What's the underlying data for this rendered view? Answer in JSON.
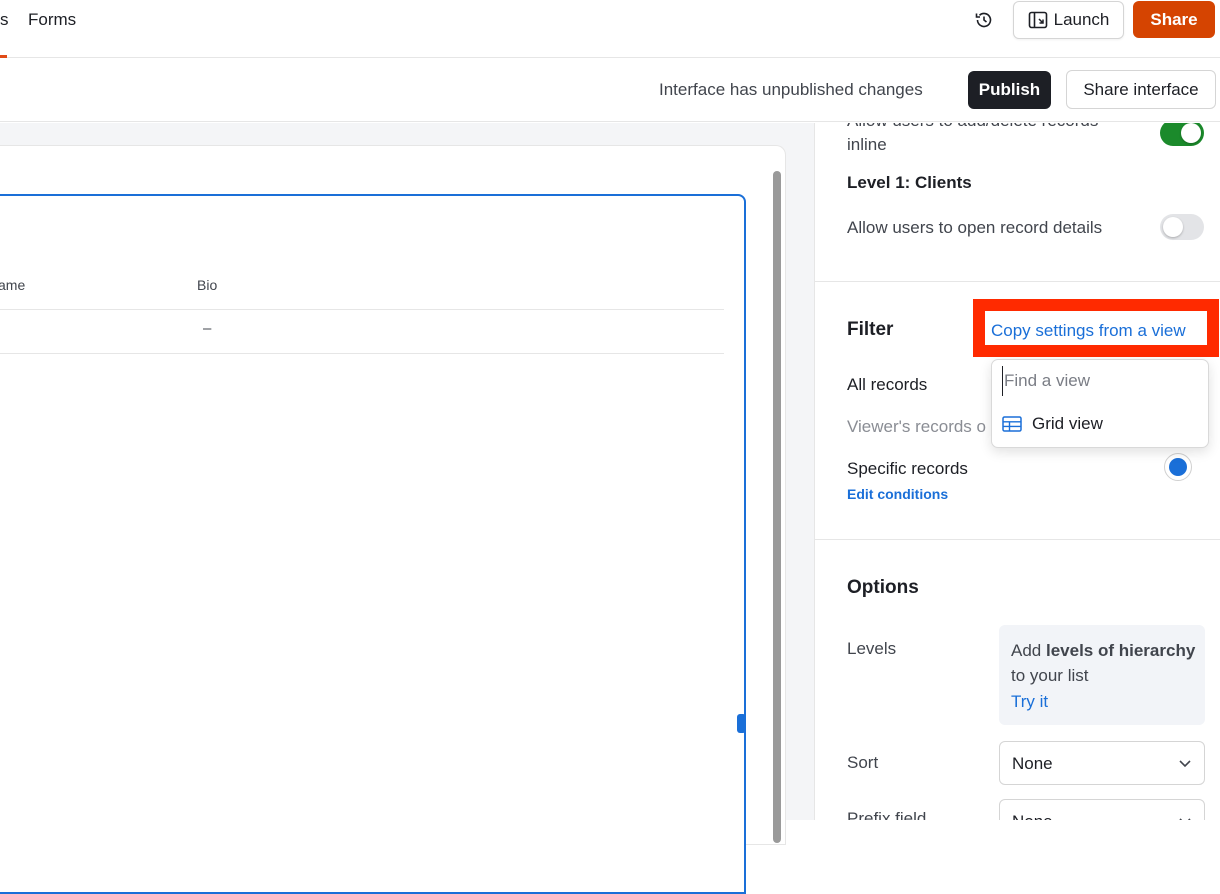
{
  "topbar": {
    "partial_tab_label": "s",
    "forms_tab_label": "Forms",
    "launch_label": "Launch",
    "share_label": "Share"
  },
  "publish_bar": {
    "status_text": "Interface has unpublished changes",
    "publish_label": "Publish",
    "share_interface_label": "Share interface"
  },
  "canvas": {
    "columns": [
      "ame",
      "Bio"
    ],
    "rows": [
      {
        "bio": "–"
      }
    ]
  },
  "panel": {
    "inline_setting_partial": "Allow users to add/delete records",
    "inline_setting_tail": "inline",
    "inline_toggle_on": true,
    "level_heading": "Level 1: Clients",
    "open_details_label": "Allow users to open record details",
    "open_details_toggle_on": false,
    "filter": {
      "title": "Filter",
      "copy_link": "Copy settings from a view",
      "all_records": "All records",
      "viewers_records": "Viewer's records o",
      "specific_records": "Specific records",
      "edit_conditions": "Edit conditions"
    },
    "dropdown": {
      "search_placeholder": "Find a view",
      "items": [
        {
          "icon": "grid-view-icon",
          "label": "Grid view"
        }
      ]
    },
    "options": {
      "title": "Options",
      "levels_label": "Levels",
      "levels_promo_prefix": "Add ",
      "levels_promo_bold": "levels of hierarchy",
      "levels_promo_suffix": " to your list",
      "try_it": "Try it",
      "sort_label": "Sort",
      "sort_value": "None",
      "prefix_field_label": "Prefix field",
      "prefix_field_value": "None"
    }
  },
  "colors": {
    "accent_blue": "#1a6fd8",
    "share_orange": "#d54401",
    "toggle_green": "#1b8a2b",
    "highlight_red": "#ff2a00"
  }
}
